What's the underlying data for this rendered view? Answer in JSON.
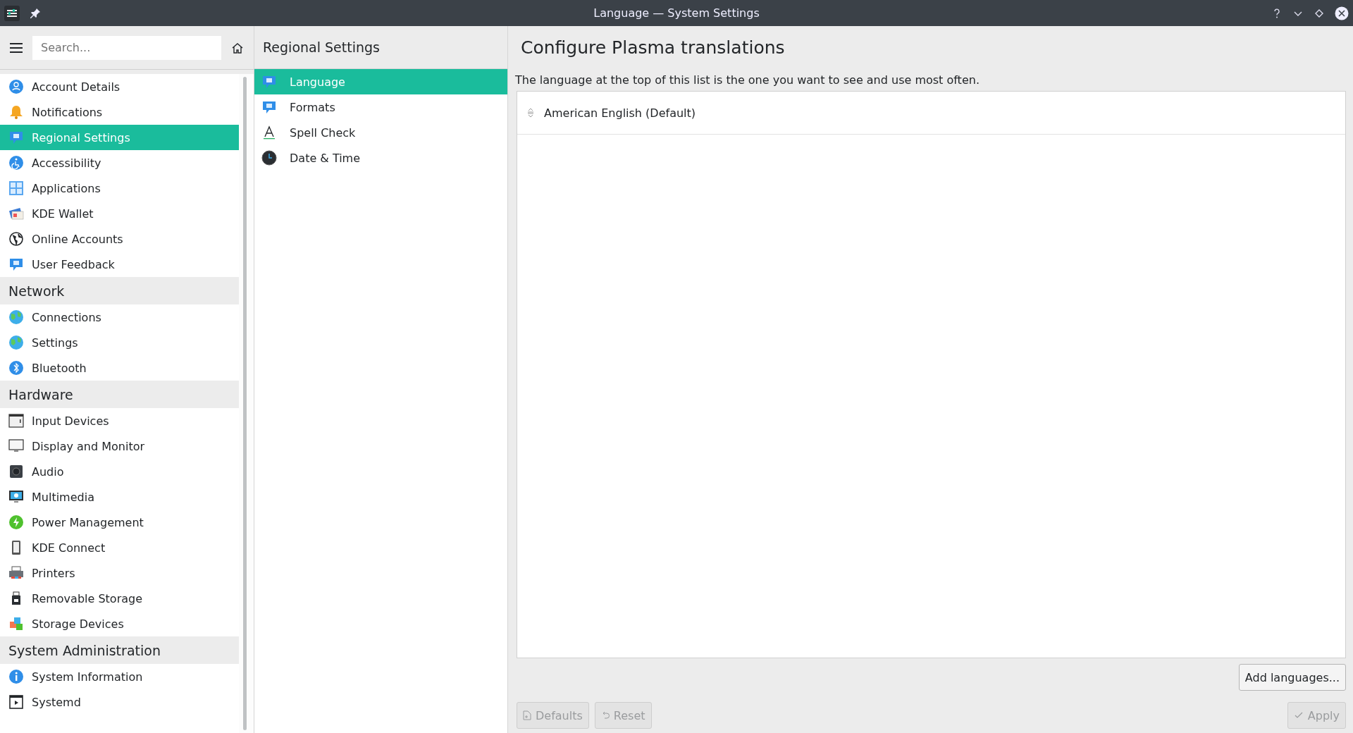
{
  "window": {
    "title": "Language — System Settings"
  },
  "sidebar": {
    "search": {
      "placeholder": "Search..."
    },
    "items": [
      {
        "kind": "item",
        "label": "Account Details",
        "selected": false
      },
      {
        "kind": "item",
        "label": "Notifications",
        "selected": false
      },
      {
        "kind": "item",
        "label": "Regional Settings",
        "selected": true
      },
      {
        "kind": "item",
        "label": "Accessibility",
        "selected": false
      },
      {
        "kind": "item",
        "label": "Applications",
        "selected": false
      },
      {
        "kind": "item",
        "label": "KDE Wallet",
        "selected": false
      },
      {
        "kind": "item",
        "label": "Online Accounts",
        "selected": false
      },
      {
        "kind": "item",
        "label": "User Feedback",
        "selected": false
      },
      {
        "kind": "category",
        "label": "Network"
      },
      {
        "kind": "item",
        "label": "Connections",
        "selected": false
      },
      {
        "kind": "item",
        "label": "Settings",
        "selected": false
      },
      {
        "kind": "item",
        "label": "Bluetooth",
        "selected": false
      },
      {
        "kind": "category",
        "label": "Hardware"
      },
      {
        "kind": "item",
        "label": "Input Devices",
        "selected": false
      },
      {
        "kind": "item",
        "label": "Display and Monitor",
        "selected": false
      },
      {
        "kind": "item",
        "label": "Audio",
        "selected": false
      },
      {
        "kind": "item",
        "label": "Multimedia",
        "selected": false
      },
      {
        "kind": "item",
        "label": "Power Management",
        "selected": false
      },
      {
        "kind": "item",
        "label": "KDE Connect",
        "selected": false
      },
      {
        "kind": "item",
        "label": "Printers",
        "selected": false
      },
      {
        "kind": "item",
        "label": "Removable Storage",
        "selected": false
      },
      {
        "kind": "item",
        "label": "Storage Devices",
        "selected": false
      },
      {
        "kind": "category",
        "label": "System Administration"
      },
      {
        "kind": "item",
        "label": "System Information",
        "selected": false
      },
      {
        "kind": "item",
        "label": "Systemd",
        "selected": false
      }
    ]
  },
  "subpanel": {
    "title": "Regional Settings",
    "items": [
      {
        "label": "Language",
        "selected": true
      },
      {
        "label": "Formats",
        "selected": false
      },
      {
        "label": "Spell Check",
        "selected": false
      },
      {
        "label": "Date & Time",
        "selected": false
      }
    ]
  },
  "content": {
    "title": "Configure Plasma translations",
    "description": "The language at the top of this list is the one you want to see and use most often.",
    "languages": [
      "American English (Default)"
    ],
    "add_button": {
      "label": "Add languages...",
      "disabled": false
    }
  },
  "footer": {
    "buttons": [
      {
        "kind": "defaults",
        "label": "Defaults",
        "disabled": true
      },
      {
        "kind": "reset",
        "label": "Reset",
        "disabled": true
      },
      {
        "kind": "apply",
        "label": "Apply",
        "disabled": true
      }
    ]
  }
}
